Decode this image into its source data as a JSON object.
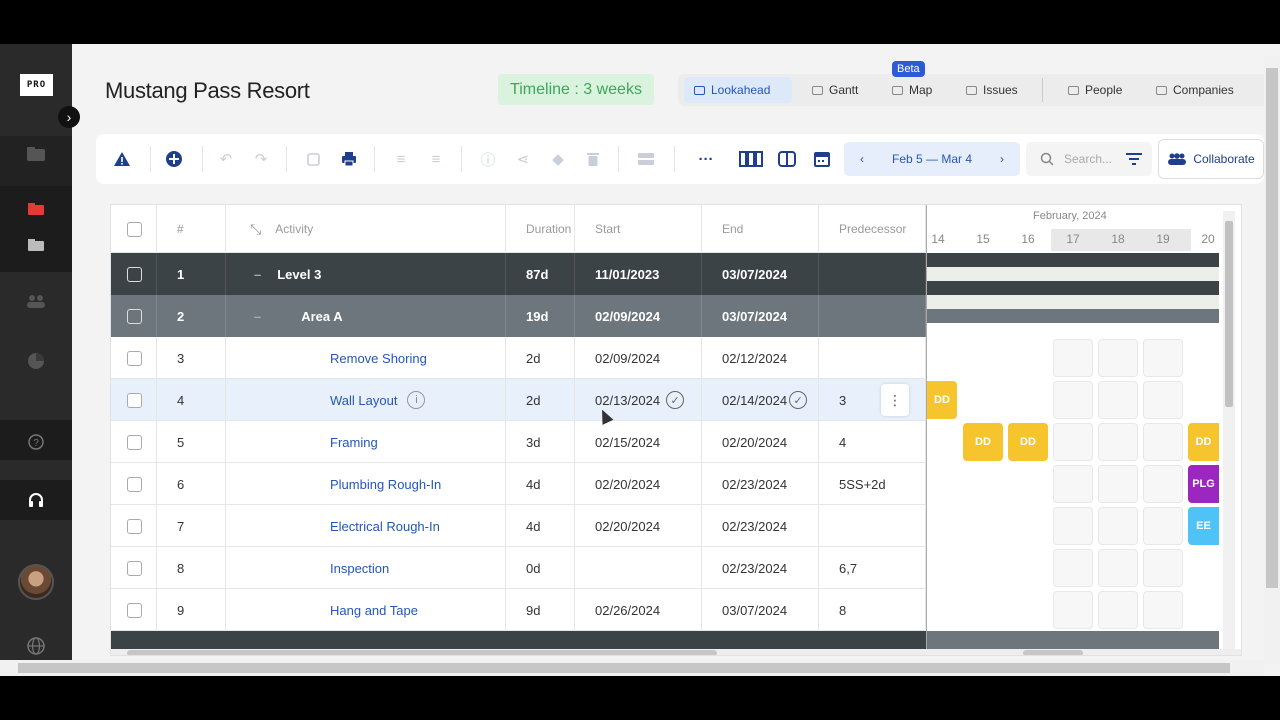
{
  "app": {
    "logo_text": "PRO",
    "project_title": "Mustang Pass Resort",
    "timeline_badge": "Timeline : 3 weeks"
  },
  "view_tabs": [
    {
      "label": "Lookahead",
      "icon": "lookahead-icon",
      "active": true
    },
    {
      "label": "Gantt",
      "icon": "gantt-icon"
    },
    {
      "label": "Map",
      "icon": "map-icon",
      "badge": "Beta"
    },
    {
      "label": "Issues",
      "icon": "issues-icon"
    },
    {
      "label": "People",
      "icon": "people-icon"
    },
    {
      "label": "Companies",
      "icon": "companies-icon"
    }
  ],
  "toolbar": {
    "date_range": "Feb 5 — Mar 4",
    "search_placeholder": "Search...",
    "collaborate_label": "Collaborate"
  },
  "grid": {
    "columns": {
      "num": "#",
      "activity": "Activity",
      "duration": "Duration",
      "start": "Start",
      "end": "End",
      "predecessor": "Predecessor"
    },
    "rows": [
      {
        "num": "1",
        "activity": "Level 3",
        "duration": "87d",
        "start": "11/01/2023",
        "end": "03/07/2024",
        "pred": ""
      },
      {
        "num": "2",
        "activity": "Area A",
        "duration": "19d",
        "start": "02/09/2024",
        "end": "03/07/2024",
        "pred": ""
      },
      {
        "num": "3",
        "activity": "Remove Shoring",
        "duration": "2d",
        "start": "02/09/2024",
        "end": "02/12/2024",
        "pred": ""
      },
      {
        "num": "4",
        "activity": "Wall Layout",
        "duration": "2d",
        "start": "02/13/2024",
        "end": "02/14/2024",
        "pred": "3"
      },
      {
        "num": "5",
        "activity": "Framing",
        "duration": "3d",
        "start": "02/15/2024",
        "end": "02/20/2024",
        "pred": "4"
      },
      {
        "num": "6",
        "activity": "Plumbing Rough-In",
        "duration": "4d",
        "start": "02/20/2024",
        "end": "02/23/2024",
        "pred": "5SS+2d"
      },
      {
        "num": "7",
        "activity": "Electrical Rough-In",
        "duration": "4d",
        "start": "02/20/2024",
        "end": "02/23/2024",
        "pred": ""
      },
      {
        "num": "8",
        "activity": "Inspection",
        "duration": "0d",
        "start": "",
        "end": "02/23/2024",
        "pred": "6,7"
      },
      {
        "num": "9",
        "activity": "Hang and Tape",
        "duration": "9d",
        "start": "02/26/2024",
        "end": "03/07/2024",
        "pred": "8"
      }
    ]
  },
  "gantt": {
    "month": "February, 2024",
    "days": [
      "14",
      "15",
      "16",
      "17",
      "18",
      "19",
      "20"
    ],
    "bars": {
      "dd": "DD",
      "plg": "PLG",
      "ee": "EE"
    }
  },
  "colors": {
    "accent": "#2456b8",
    "level_row": "#3b4347",
    "area_row": "#6c767c",
    "dd": "#f6c52e",
    "plg": "#9b27c0",
    "ee": "#4fc3f7",
    "timeline_green": "#3ea659"
  }
}
